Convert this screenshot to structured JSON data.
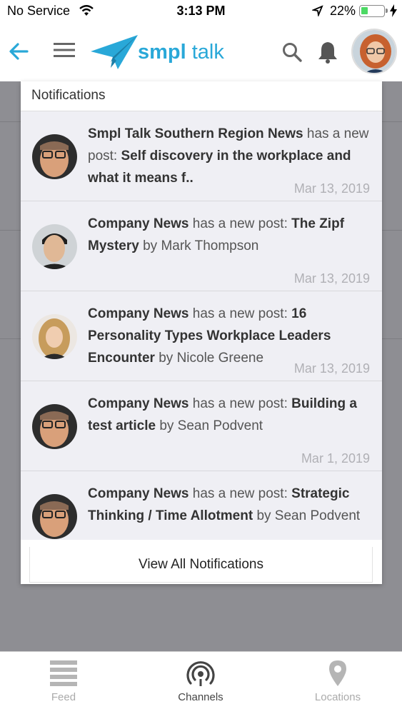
{
  "status_bar": {
    "carrier": "No Service",
    "time": "3:13 PM",
    "battery": "22%"
  },
  "header": {
    "brand_bold": "smpl",
    "brand_light": " talk"
  },
  "notifications": {
    "title": "Notifications",
    "items": [
      {
        "source": "Smpl Talk Southern Region News",
        "connector": " has a new post: ",
        "post": "Self discovery in the workplace and what it means f..",
        "by": "",
        "date": "Mar 13, 2019"
      },
      {
        "source": "Company News",
        "connector": " has a new post: ",
        "post": "The Zipf Mystery",
        "by": " by Mark Thompson",
        "date": "Mar 13, 2019"
      },
      {
        "source": "Company News",
        "connector": " has a new post: ",
        "post": "16 Personality Types Workplace Leaders Encounter",
        "by": " by Nicole Greene",
        "date": "Mar 13, 2019"
      },
      {
        "source": "Company News",
        "connector": " has a new post: ",
        "post": "Building a test article",
        "by": " by Sean Podvent",
        "date": "Mar 1, 2019"
      },
      {
        "source": "Company News",
        "connector": " has a new post: ",
        "post": "Strategic Thinking / Time Allotment",
        "by": " by Sean Podvent",
        "date": ""
      }
    ],
    "view_all": "View All Notifications"
  },
  "tabs": [
    {
      "label": "Feed",
      "icon": "feed-icon",
      "active": false
    },
    {
      "label": "Channels",
      "icon": "channels-icon",
      "active": true
    },
    {
      "label": "Locations",
      "icon": "location-pin-icon",
      "active": false
    }
  ],
  "colors": {
    "accent": "#29a8d8",
    "overlay": "#8e8e93",
    "list_bg": "#efeff4",
    "battery_green": "#4cd964"
  }
}
